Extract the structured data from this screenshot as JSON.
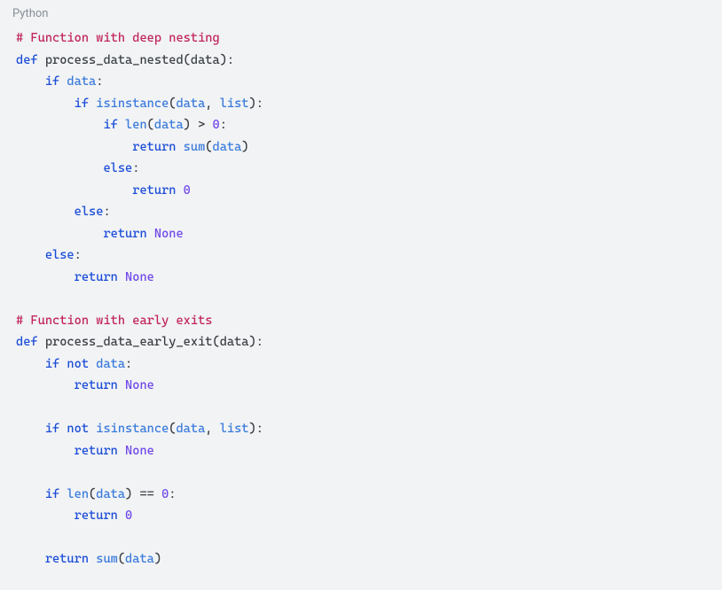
{
  "language_label": "Python",
  "code": {
    "tokens": [
      [
        {
          "t": "# Function with deep nesting",
          "c": "comment"
        }
      ],
      [
        {
          "t": "def ",
          "c": "keyword"
        },
        {
          "t": "process_data_nested",
          "c": "func"
        },
        {
          "t": "(",
          "c": "punct"
        },
        {
          "t": "data",
          "c": "param"
        },
        {
          "t": "):",
          "c": "punct"
        }
      ],
      [
        {
          "t": "    ",
          "c": ""
        },
        {
          "t": "if ",
          "c": "keyword"
        },
        {
          "t": "data",
          "c": "name"
        },
        {
          "t": ":",
          "c": "punct"
        }
      ],
      [
        {
          "t": "        ",
          "c": ""
        },
        {
          "t": "if ",
          "c": "keyword"
        },
        {
          "t": "isinstance",
          "c": "builtin"
        },
        {
          "t": "(",
          "c": "punct"
        },
        {
          "t": "data",
          "c": "name"
        },
        {
          "t": ", ",
          "c": "punct"
        },
        {
          "t": "list",
          "c": "builtin"
        },
        {
          "t": "):",
          "c": "punct"
        }
      ],
      [
        {
          "t": "            ",
          "c": ""
        },
        {
          "t": "if ",
          "c": "keyword"
        },
        {
          "t": "len",
          "c": "builtin"
        },
        {
          "t": "(",
          "c": "punct"
        },
        {
          "t": "data",
          "c": "name"
        },
        {
          "t": ") > ",
          "c": "op"
        },
        {
          "t": "0",
          "c": "num"
        },
        {
          "t": ":",
          "c": "punct"
        }
      ],
      [
        {
          "t": "                ",
          "c": ""
        },
        {
          "t": "return ",
          "c": "keyword"
        },
        {
          "t": "sum",
          "c": "builtin"
        },
        {
          "t": "(",
          "c": "punct"
        },
        {
          "t": "data",
          "c": "name"
        },
        {
          "t": ")",
          "c": "punct"
        }
      ],
      [
        {
          "t": "            ",
          "c": ""
        },
        {
          "t": "else",
          "c": "keyword"
        },
        {
          "t": ":",
          "c": "punct"
        }
      ],
      [
        {
          "t": "                ",
          "c": ""
        },
        {
          "t": "return ",
          "c": "keyword"
        },
        {
          "t": "0",
          "c": "num"
        }
      ],
      [
        {
          "t": "        ",
          "c": ""
        },
        {
          "t": "else",
          "c": "keyword"
        },
        {
          "t": ":",
          "c": "punct"
        }
      ],
      [
        {
          "t": "            ",
          "c": ""
        },
        {
          "t": "return ",
          "c": "keyword"
        },
        {
          "t": "None",
          "c": "const"
        }
      ],
      [
        {
          "t": "    ",
          "c": ""
        },
        {
          "t": "else",
          "c": "keyword"
        },
        {
          "t": ":",
          "c": "punct"
        }
      ],
      [
        {
          "t": "        ",
          "c": ""
        },
        {
          "t": "return ",
          "c": "keyword"
        },
        {
          "t": "None",
          "c": "const"
        }
      ],
      [],
      [
        {
          "t": "# Function with early exits",
          "c": "comment"
        }
      ],
      [
        {
          "t": "def ",
          "c": "keyword"
        },
        {
          "t": "process_data_early_exit",
          "c": "func"
        },
        {
          "t": "(",
          "c": "punct"
        },
        {
          "t": "data",
          "c": "param"
        },
        {
          "t": "):",
          "c": "punct"
        }
      ],
      [
        {
          "t": "    ",
          "c": ""
        },
        {
          "t": "if ",
          "c": "keyword"
        },
        {
          "t": "not ",
          "c": "keyword"
        },
        {
          "t": "data",
          "c": "name"
        },
        {
          "t": ":",
          "c": "punct"
        }
      ],
      [
        {
          "t": "        ",
          "c": ""
        },
        {
          "t": "return ",
          "c": "keyword"
        },
        {
          "t": "None",
          "c": "const"
        }
      ],
      [],
      [
        {
          "t": "    ",
          "c": ""
        },
        {
          "t": "if ",
          "c": "keyword"
        },
        {
          "t": "not ",
          "c": "keyword"
        },
        {
          "t": "isinstance",
          "c": "builtin"
        },
        {
          "t": "(",
          "c": "punct"
        },
        {
          "t": "data",
          "c": "name"
        },
        {
          "t": ", ",
          "c": "punct"
        },
        {
          "t": "list",
          "c": "builtin"
        },
        {
          "t": "):",
          "c": "punct"
        }
      ],
      [
        {
          "t": "        ",
          "c": ""
        },
        {
          "t": "return ",
          "c": "keyword"
        },
        {
          "t": "None",
          "c": "const"
        }
      ],
      [],
      [
        {
          "t": "    ",
          "c": ""
        },
        {
          "t": "if ",
          "c": "keyword"
        },
        {
          "t": "len",
          "c": "builtin"
        },
        {
          "t": "(",
          "c": "punct"
        },
        {
          "t": "data",
          "c": "name"
        },
        {
          "t": ") == ",
          "c": "op"
        },
        {
          "t": "0",
          "c": "num"
        },
        {
          "t": ":",
          "c": "punct"
        }
      ],
      [
        {
          "t": "        ",
          "c": ""
        },
        {
          "t": "return ",
          "c": "keyword"
        },
        {
          "t": "0",
          "c": "num"
        }
      ],
      [],
      [
        {
          "t": "    ",
          "c": ""
        },
        {
          "t": "return ",
          "c": "keyword"
        },
        {
          "t": "sum",
          "c": "builtin"
        },
        {
          "t": "(",
          "c": "punct"
        },
        {
          "t": "data",
          "c": "name"
        },
        {
          "t": ")",
          "c": "punct"
        }
      ]
    ]
  }
}
